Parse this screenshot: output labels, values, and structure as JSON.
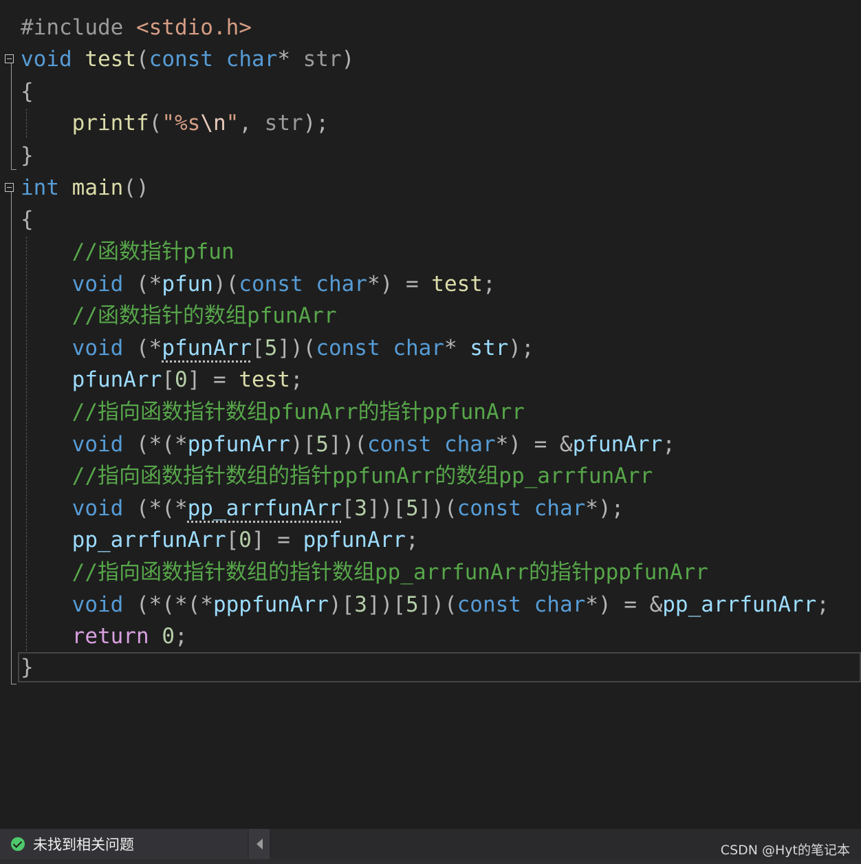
{
  "code": {
    "include": {
      "directive": "#include",
      "header": "<stdio.h>"
    },
    "test_func": {
      "ret": "void",
      "name": "test",
      "p1": "(",
      "k1": "const",
      "k2": "char",
      "star": "*",
      "param": "str",
      "p2": ")",
      "open_brace": "{",
      "close_brace": "}",
      "printf_name": "printf",
      "printf_open": "(",
      "fmt": "\"%s",
      "esc": "\\n",
      "fmt_end": "\"",
      "comma": ",",
      "printf_arg": "str",
      "printf_close": ");"
    },
    "main_func": {
      "ret": "int",
      "name": "main",
      "parens": "()",
      "open_brace": "{",
      "close_brace": "}",
      "c1": "//函数指针pfun",
      "l1": {
        "kw": "void",
        "a": "(*",
        "name": "pfun",
        "b": ")(",
        "k1": "const",
        "k2": "char",
        "c": "*) = ",
        "fn": "test",
        "d": ";"
      },
      "c2": "//函数指针的数组pfunArr",
      "l2": {
        "kw": "void",
        "a": "(*",
        "name": "pfunArr",
        "b": "[",
        "num": "5",
        "c": "])(",
        "k1": "const",
        "k2": "char",
        "d": "* ",
        "param": "str",
        "e": ");"
      },
      "l3": {
        "name": "pfunArr",
        "a": "[",
        "num": "0",
        "b": "] = ",
        "fn": "test",
        "c": ";"
      },
      "c3": "//指向函数指针数组pfunArr的指针ppfunArr",
      "l4": {
        "kw": "void",
        "a": "(*(*",
        "name": "ppfunArr",
        "b": ")[",
        "num": "5",
        "c": "])(",
        "k1": "const",
        "k2": "char",
        "d": "*) = &",
        "ref": "pfunArr",
        "e": ";"
      },
      "c4": "//指向函数指针数组的指针ppfunArr的数组pp_arrfunArr",
      "l5": {
        "kw": "void",
        "a": "(*(*",
        "name": "pp_arrfunArr",
        "b": "[",
        "num1": "3",
        "c": "])[",
        "num2": "5",
        "d": "])(",
        "k1": "const",
        "k2": "char",
        "e": "*);"
      },
      "l6": {
        "name": "pp_arrfunArr",
        "a": "[",
        "num": "0",
        "b": "] = ",
        "ref": "ppfunArr",
        "c": ";"
      },
      "c5": "//指向函数指针数组的指针数组pp_arrfunArr的指针pppfunArr",
      "l7": {
        "kw": "void",
        "a": "(*(*(*",
        "name": "pppfunArr",
        "b": ")[",
        "num1": "3",
        "c": "])[",
        "num2": "5",
        "d": "])(",
        "k1": "const",
        "k2": "char",
        "e": "*) = &",
        "ref": "pp_arrfunArr",
        "f": ";"
      },
      "l8": {
        "kw": "return",
        "num": "0",
        "a": ";"
      }
    }
  },
  "status": {
    "message": "未找到相关问题",
    "watermark": "CSDN @Hyt的笔记本"
  },
  "colors": {
    "background": "#1e1e1e",
    "keyword": "#569cd6",
    "comment": "#57a64a",
    "function": "#dcdcaa",
    "variable": "#9cdcfe",
    "ok": "#4ec96b"
  },
  "icons": [
    "collapse-icon",
    "check-circle-icon",
    "arrow-left-icon"
  ]
}
